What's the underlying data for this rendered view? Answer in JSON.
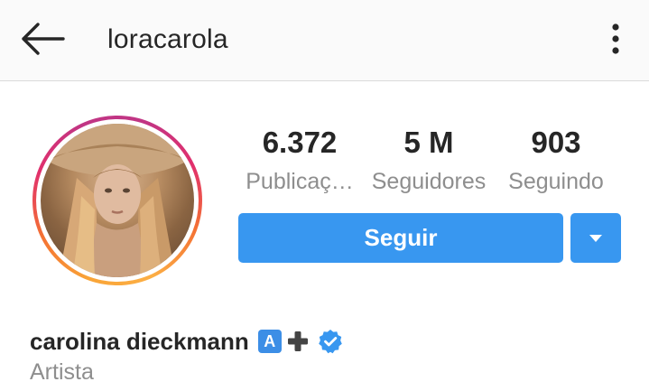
{
  "header": {
    "username": "loracarola",
    "back_icon": "arrow-left-icon",
    "menu_icon": "more-vertical-icon"
  },
  "profile": {
    "stats": {
      "posts": {
        "value": "6.372",
        "label": "Publicaç…"
      },
      "followers": {
        "value": "5 M",
        "label": "Seguidores"
      },
      "following": {
        "value": "903",
        "label": "Seguindo"
      }
    },
    "follow_label": "Seguir",
    "full_name": "carolina dieckmann",
    "name_emoji_letter": "A",
    "category": "Artista"
  },
  "colors": {
    "accent": "#3897f0",
    "text_primary": "#262626",
    "text_secondary": "#8e8e8e",
    "ring_start": "#fcaf45",
    "ring_end": "#c13584"
  }
}
